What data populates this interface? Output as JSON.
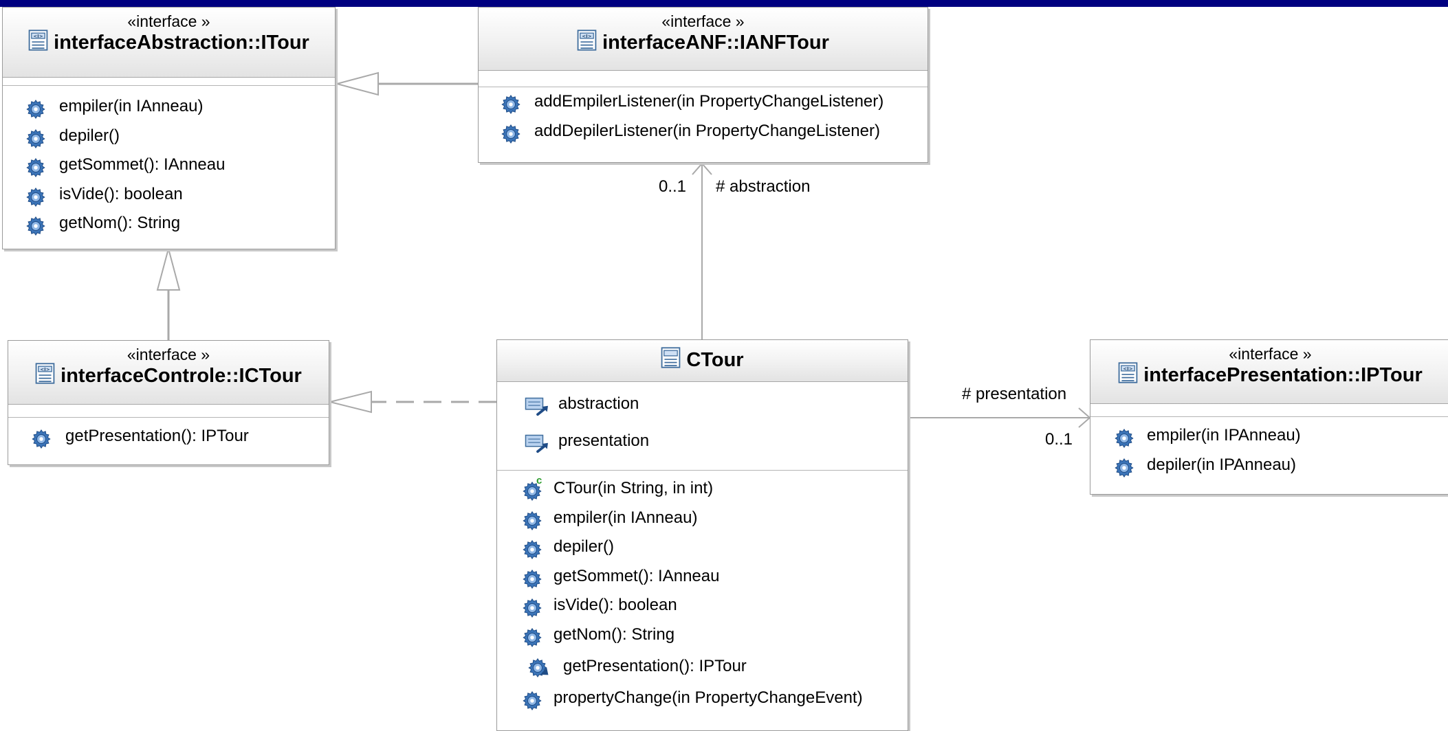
{
  "diagram": {
    "itour": {
      "stereotype": "«interface »",
      "name": "interfaceAbstraction::ITour",
      "operations": [
        "empiler(in IAnneau)",
        "depiler()",
        "getSommet(): IAnneau",
        "isVide(): boolean",
        "getNom(): String"
      ]
    },
    "ianftour": {
      "stereotype": "«interface »",
      "name": "interfaceANF::IANFTour",
      "operations": [
        "addEmpilerListener(in PropertyChangeListener)",
        "addDepilerListener(in PropertyChangeListener)"
      ]
    },
    "ictour": {
      "stereotype": "«interface »",
      "name": "interfaceControle::ICTour",
      "operations": [
        "getPresentation(): IPTour"
      ]
    },
    "ctour": {
      "name": "CTour",
      "attributes": [
        "abstraction",
        "presentation"
      ],
      "operations": [
        "CTour(in String, in int)",
        "empiler(in IAnneau)",
        "depiler()",
        "getSommet(): IAnneau",
        "isVide(): boolean",
        "getNom(): String",
        "getPresentation(): IPTour",
        "propertyChange(in PropertyChangeEvent)"
      ]
    },
    "iptour": {
      "stereotype": "«interface »",
      "name": "interfacePresentation::IPTour",
      "operations": [
        "empiler(in IPAnneau)",
        "depiler(in IPAnneau)"
      ]
    },
    "associations": {
      "abstraction": {
        "role": "# abstraction",
        "multiplicity": "0..1"
      },
      "presentation": {
        "role": "# presentation",
        "multiplicity": "0..1"
      }
    }
  },
  "icons": {
    "interface": "interface-icon",
    "class": "class-icon",
    "operation": "operation-gear-icon",
    "constructor": "constructor-gear-icon",
    "overridden_operation": "overridden-operation-gear-icon",
    "attribute": "attribute-field-icon"
  },
  "colors": {
    "title_bar": "#000080",
    "box_border": "#9a9a9a",
    "gear": "#2f65a8",
    "connector": "#a9a9a9"
  }
}
